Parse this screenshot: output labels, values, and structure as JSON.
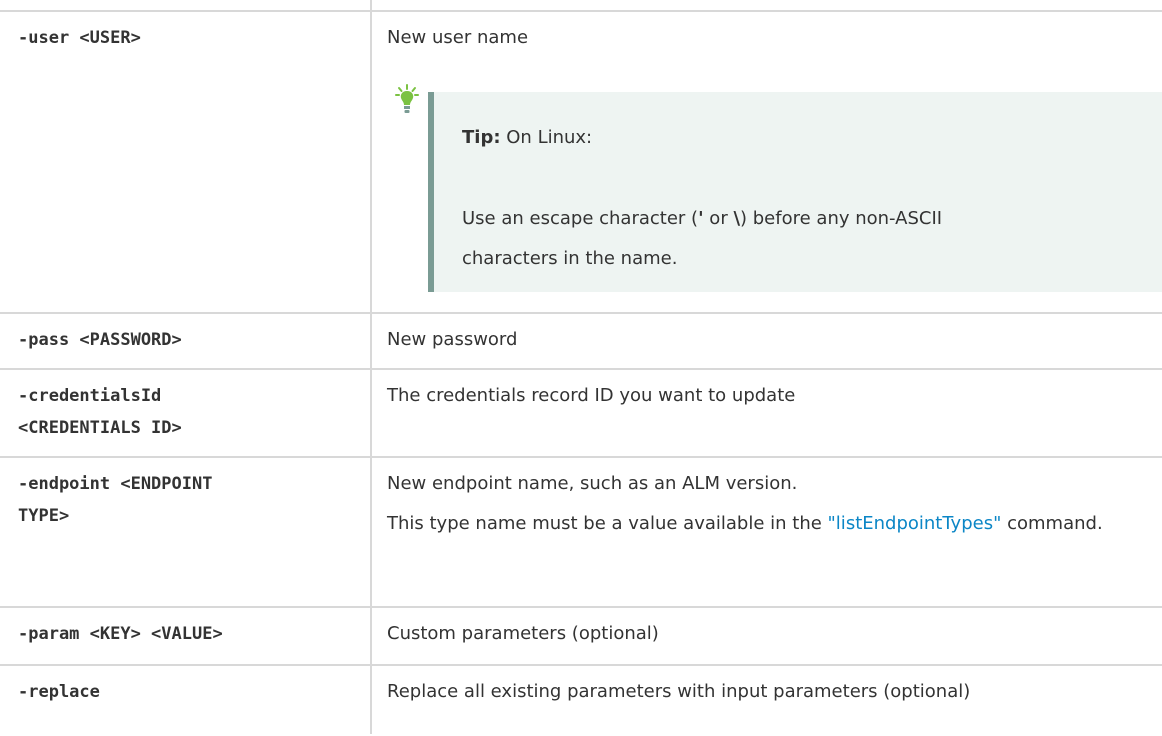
{
  "rows": [
    {
      "param": "-user <USER>",
      "desc": "New user name",
      "tip": {
        "label": "Tip:",
        "line1": "On Linux:",
        "text_before": "Use an escape character (",
        "char1": "'",
        "text_or": " or ",
        "char2": "\\",
        "text_after": ") before any non-ASCII characters in the name."
      }
    },
    {
      "param": "-pass <PASSWORD>",
      "desc": "New password"
    },
    {
      "param_line1": "-credentialsId",
      "param_line2": "<CREDENTIALS ID>",
      "desc": "The credentials record ID you want to update"
    },
    {
      "param_line1": "-endpoint <ENDPOINT",
      "param_line2": "TYPE>",
      "desc": "New endpoint name, such as an ALM version.",
      "desc2_before": "This type name must be a value available in the ",
      "desc2_link": "\"listEndpointTypes\"",
      "desc2_after": " command."
    },
    {
      "param": "-param <KEY> <VALUE>",
      "desc": "Custom parameters (optional)"
    },
    {
      "param": "-replace",
      "desc": "Replace all existing parameters with input parameters (optional)"
    }
  ],
  "icons": {
    "tip": "lightbulb-icon"
  },
  "colors": {
    "link": "#0b86c6",
    "tip_bg": "#eef4f2",
    "tip_border": "#7a9b94",
    "grid": "#d8d8d8"
  }
}
